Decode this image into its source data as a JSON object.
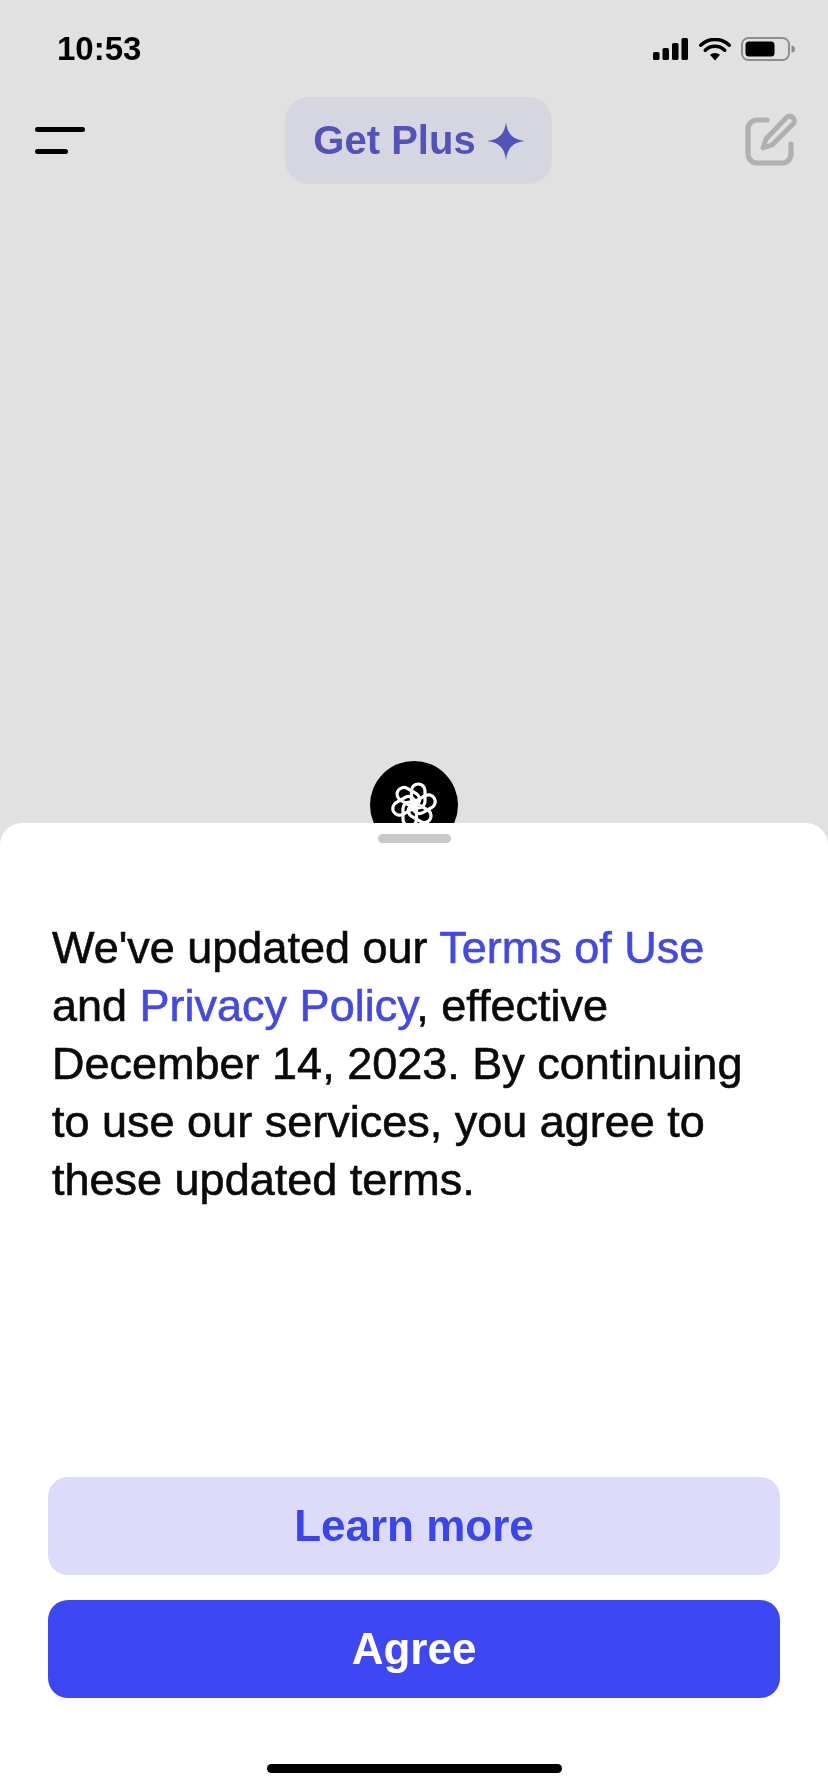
{
  "status_bar": {
    "time": "10:53"
  },
  "top_bar": {
    "upgrade_button": {
      "label": "Get Plus"
    },
    "compose_button": {
      "disabled": true
    }
  },
  "notice": {
    "parts": [
      {
        "kind": "text",
        "text": "We've updated our "
      },
      {
        "kind": "link",
        "text": "Terms of Use"
      },
      {
        "kind": "text",
        "text": " and "
      },
      {
        "kind": "link",
        "text": "Privacy Policy"
      },
      {
        "kind": "text",
        "text": ", effective December 14, 2023. By continuing to use our services, you agree to these updated terms."
      }
    ]
  },
  "buttons": [
    {
      "label": "Learn more",
      "kind": "secondary"
    },
    {
      "label": "Agree",
      "kind": "primary"
    }
  ]
}
